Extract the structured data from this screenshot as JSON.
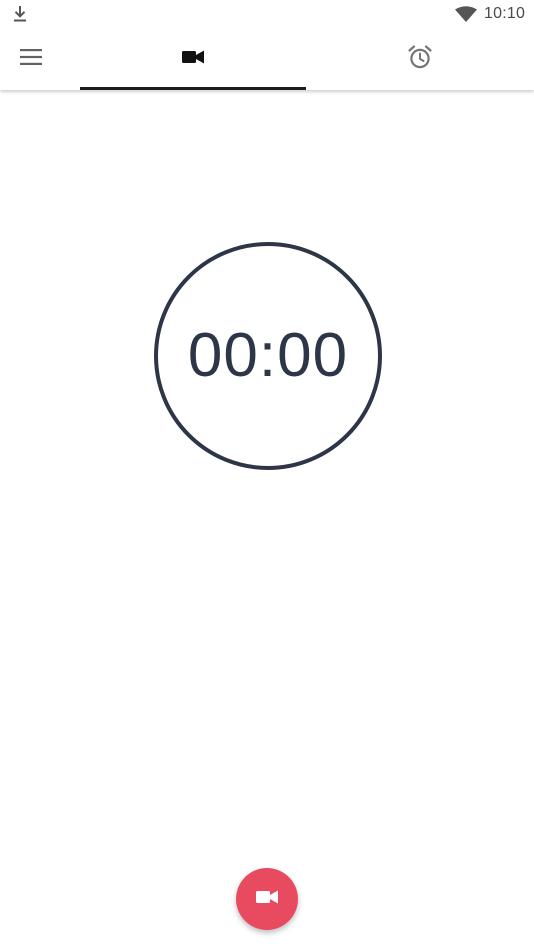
{
  "status_bar": {
    "time": "10:10",
    "download_icon": "download-icon",
    "wifi_icon": "wifi-icon"
  },
  "toolbar": {
    "menu_icon": "menu-icon",
    "tabs": [
      {
        "id": "record",
        "icon": "videocam-icon",
        "selected": true
      },
      {
        "id": "alarm",
        "icon": "alarm-clock-icon",
        "selected": false
      }
    ]
  },
  "timer": {
    "display": "00:00"
  },
  "fab": {
    "icon": "videocam-icon",
    "color": "#e84a60"
  },
  "colors": {
    "accent": "#e84a60",
    "timer": "#2d3648",
    "indicator": "#1c1c1c"
  }
}
